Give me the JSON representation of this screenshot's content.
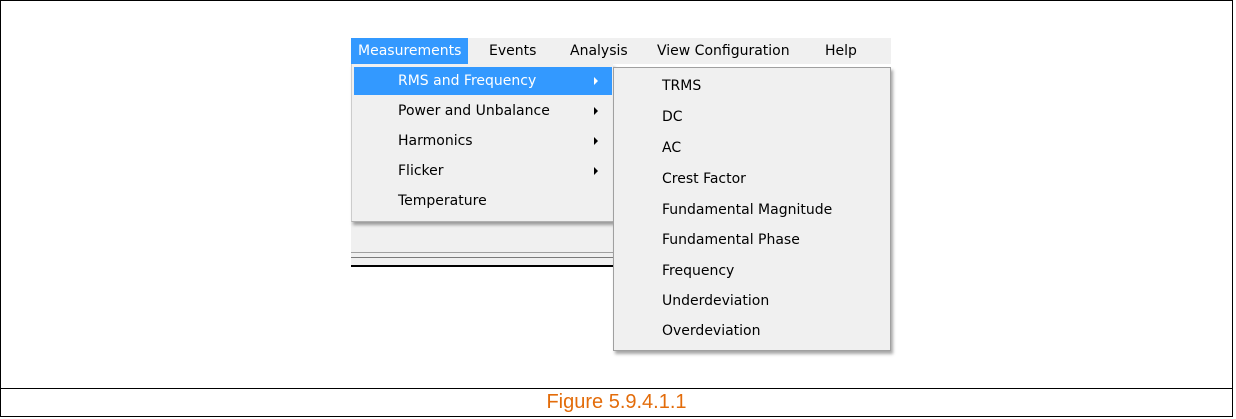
{
  "menubar": {
    "items": [
      {
        "label": "Measurements",
        "active": true
      },
      {
        "label": "Events",
        "active": false
      },
      {
        "label": "Analysis",
        "active": false
      },
      {
        "label": "View Configuration",
        "active": false
      },
      {
        "label": "Help",
        "active": false
      }
    ]
  },
  "dropdown": {
    "items": [
      {
        "label": "RMS and Frequency",
        "has_submenu": true,
        "highlighted": true
      },
      {
        "label": "Power and Unbalance",
        "has_submenu": true,
        "highlighted": false
      },
      {
        "label": "Harmonics",
        "has_submenu": true,
        "highlighted": false
      },
      {
        "label": "Flicker",
        "has_submenu": true,
        "highlighted": false
      },
      {
        "label": "Temperature",
        "has_submenu": false,
        "highlighted": false
      }
    ]
  },
  "submenu": {
    "items": [
      {
        "label": "TRMS"
      },
      {
        "label": "DC"
      },
      {
        "label": "AC"
      },
      {
        "label": "Crest Factor"
      },
      {
        "label": "Fundamental Magnitude"
      },
      {
        "label": "Fundamental Phase"
      },
      {
        "label": "Frequency"
      },
      {
        "label": "Underdeviation"
      },
      {
        "label": "Overdeviation"
      }
    ]
  },
  "caption": "Figure 5.9.4.1.1",
  "colors": {
    "highlight": "#3399ff",
    "menu_background": "#f0f0f0",
    "caption": "#e36c0a"
  }
}
